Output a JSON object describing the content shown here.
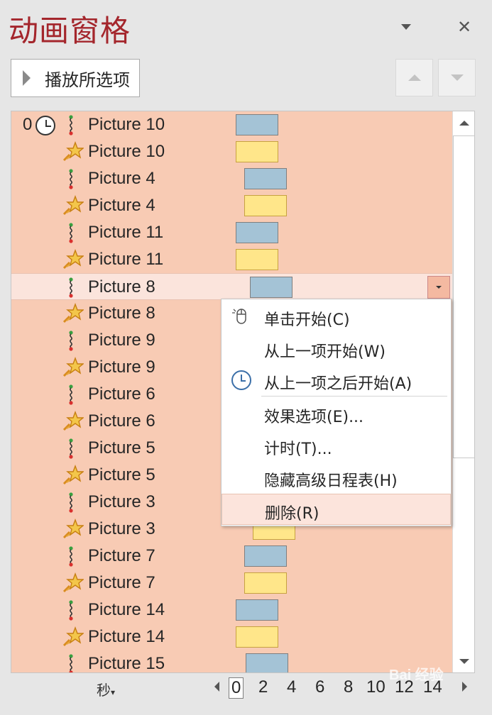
{
  "pane": {
    "title": "动画窗格"
  },
  "toolbar": {
    "play_label": "播放所选项"
  },
  "list": {
    "start_number": "0",
    "rows": [
      {
        "label": "Picture 10",
        "effect": "path",
        "bar": "blue"
      },
      {
        "label": "Picture 10",
        "effect": "emphasis",
        "bar": "yellow"
      },
      {
        "label": "Picture 4",
        "effect": "path",
        "bar": "blue"
      },
      {
        "label": "Picture 4",
        "effect": "emphasis",
        "bar": "yellow"
      },
      {
        "label": "Picture 11",
        "effect": "path",
        "bar": "blue"
      },
      {
        "label": "Picture 11",
        "effect": "emphasis",
        "bar": "yellow"
      },
      {
        "label": "Picture 8",
        "effect": "path",
        "bar": "blue",
        "selected": true
      },
      {
        "label": "Picture 8",
        "effect": "emphasis",
        "bar": "yellow"
      },
      {
        "label": "Picture 9",
        "effect": "path",
        "bar": "blue"
      },
      {
        "label": "Picture 9",
        "effect": "emphasis",
        "bar": "yellow"
      },
      {
        "label": "Picture 6",
        "effect": "path",
        "bar": "blue"
      },
      {
        "label": "Picture 6",
        "effect": "emphasis",
        "bar": "yellow"
      },
      {
        "label": "Picture 5",
        "effect": "path",
        "bar": "blue"
      },
      {
        "label": "Picture 5",
        "effect": "emphasis",
        "bar": "yellow"
      },
      {
        "label": "Picture 3",
        "effect": "path",
        "bar": "blue"
      },
      {
        "label": "Picture 3",
        "effect": "emphasis",
        "bar": "yellow"
      },
      {
        "label": "Picture 7",
        "effect": "path",
        "bar": "blue"
      },
      {
        "label": "Picture 7",
        "effect": "emphasis",
        "bar": "yellow"
      },
      {
        "label": "Picture 14",
        "effect": "path",
        "bar": "blue"
      },
      {
        "label": "Picture 14",
        "effect": "emphasis",
        "bar": "yellow"
      },
      {
        "label": "Picture 15",
        "effect": "path",
        "bar": "blue"
      }
    ]
  },
  "context_menu": {
    "items": [
      {
        "label": "单击开始(C)",
        "icon": "mouse-icon"
      },
      {
        "label": "从上一项开始(W)",
        "icon": ""
      },
      {
        "label": "从上一项之后开始(A)",
        "icon": "clock-icon"
      },
      {
        "label": "效果选项(E)...",
        "icon": ""
      },
      {
        "label": "计时(T)...",
        "icon": ""
      },
      {
        "label": "隐藏高级日程表(H)",
        "icon": ""
      },
      {
        "label": "删除(R)",
        "icon": "",
        "highlighted": true
      }
    ]
  },
  "timeline": {
    "unit_label": "秒",
    "ticks": [
      "0",
      "2",
      "4",
      "6",
      "8",
      "10",
      "12",
      "14"
    ]
  },
  "watermark": {
    "text": "Bai 经验"
  },
  "colors": {
    "title": "#a4262c",
    "list_bg": "#f8cbb4",
    "bar_blue": "#a4c3d6",
    "bar_yellow": "#ffe68a",
    "menu_highlight": "#fce4dc"
  }
}
